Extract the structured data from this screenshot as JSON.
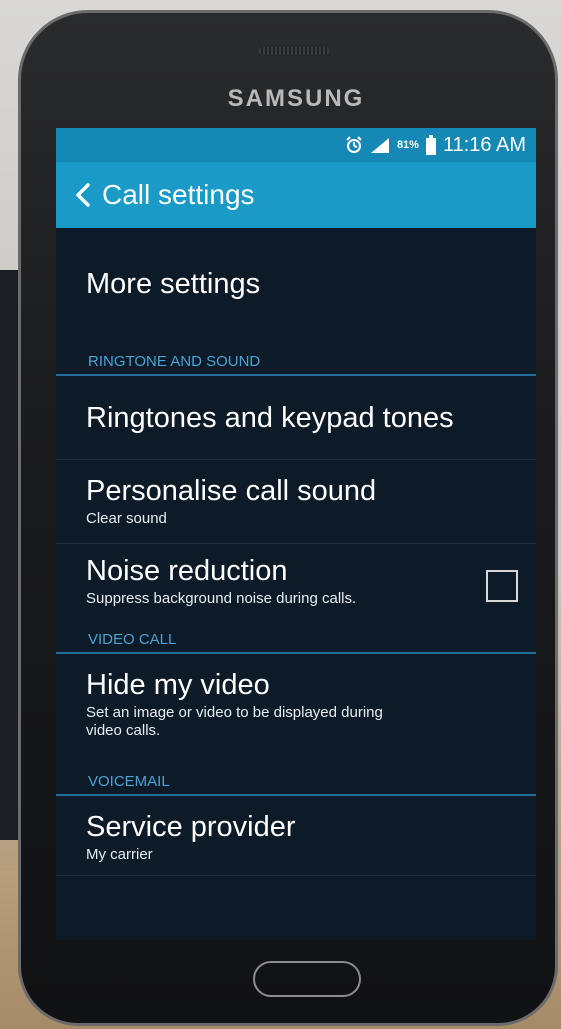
{
  "device": {
    "brand": "SAMSUNG"
  },
  "status_bar": {
    "battery_percent": "81%",
    "time": "11:16 AM",
    "icons": [
      "alarm-icon",
      "signal-icon",
      "battery-icon"
    ]
  },
  "action_bar": {
    "title": "Call settings",
    "back_icon": "chevron-left-icon"
  },
  "list": {
    "more_settings": {
      "title": "More settings"
    },
    "ringtone_header": "RINGTONE AND SOUND",
    "ringtones": {
      "title": "Ringtones and keypad tones"
    },
    "personalise": {
      "title": "Personalise call sound",
      "subtitle": "Clear sound"
    },
    "noise": {
      "title": "Noise reduction",
      "subtitle": "Suppress background noise during calls.",
      "checked": false
    },
    "video_header": "VIDEO CALL",
    "hide_video": {
      "title": "Hide my video",
      "subtitle": "Set an image or video to be displayed during video calls."
    },
    "voicemail_header": "VOICEMAIL",
    "service_provider": {
      "title": "Service provider",
      "subtitle": "My carrier"
    }
  },
  "colors": {
    "status_bar": "#1588b6",
    "action_bar": "#1a9ac7",
    "screen_bg": "#0d1a27",
    "section_header_text": "#4aa3d6"
  }
}
